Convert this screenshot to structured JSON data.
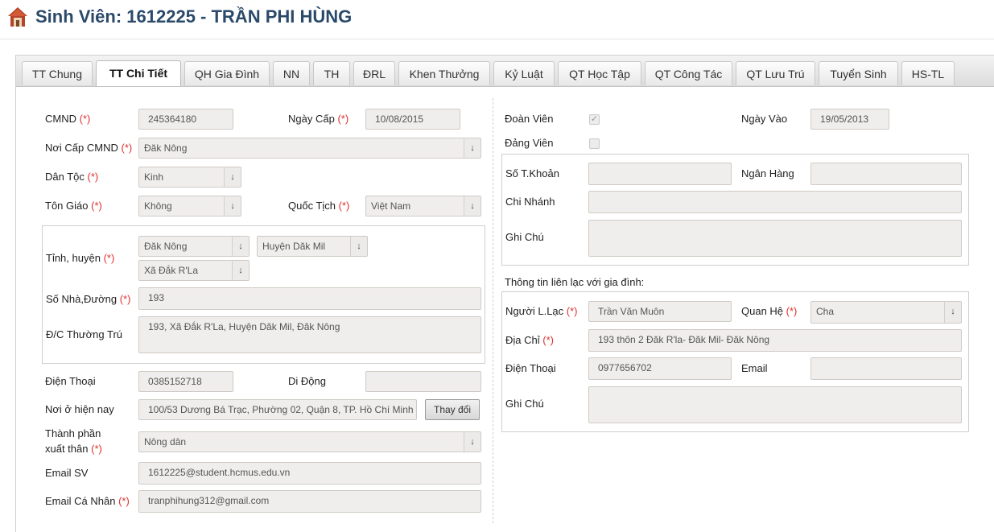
{
  "header": {
    "title": "Sinh Viên: 1612225 - TRẦN PHI HÙNG",
    "icon": "home-icon"
  },
  "tabs": [
    "TT Chung",
    "TT Chi Tiết",
    "QH Gia Đình",
    "NN",
    "TH",
    "ĐRL",
    "Khen Thưởng",
    "Kỷ Luật",
    "QT Học Tập",
    "QT Công Tác",
    "QT Lưu Trú",
    "Tuyển Sinh",
    "HS-TL"
  ],
  "active_tab": "TT Chi Tiết",
  "required_mark": "(*)",
  "left": {
    "cmnd": {
      "label": "CMND",
      "value": "245364180"
    },
    "ngay_cap": {
      "label": "Ngày Cấp",
      "value": "10/08/2015"
    },
    "noi_cap": {
      "label": "Nơi Cấp CMND",
      "value": "Đăk Nông"
    },
    "dan_toc": {
      "label": "Dân Tộc",
      "value": "Kinh"
    },
    "ton_giao": {
      "label": "Tôn Giáo",
      "value": "Không"
    },
    "quoc_tich": {
      "label": "Quốc Tịch",
      "value": "Việt Nam"
    },
    "tinh_huyen": {
      "label": "Tỉnh, huyện",
      "tinh": "Đăk Nông",
      "huyen": "Huyện Dăk Mil",
      "xa": "Xã Đắk R'La"
    },
    "so_nha": {
      "label": "Số Nhà,Đường",
      "value": "193"
    },
    "dc_thuong_tru": {
      "label": "Đ/C Thường Trú",
      "value": "193, Xã Đắk R'La, Huyện Dăk Mil, Đăk Nông"
    },
    "dien_thoai": {
      "label": "Điện Thoại",
      "value": "0385152718"
    },
    "di_dong": {
      "label": "Di Động",
      "value": ""
    },
    "noi_o": {
      "label": "Nơi ở hiện nay",
      "value": "100/53 Dương Bá Trạc, Phường 02, Quận 8, TP. Hồ Chí Minh",
      "button": "Thay đổi"
    },
    "thanh_phan": {
      "label_line1": "Thành phần",
      "label_line2": "xuất thân",
      "value": "Nông dân"
    },
    "email_sv": {
      "label": "Email SV",
      "value": "1612225@student.hcmus.edu.vn"
    },
    "email_cn": {
      "label": "Email Cá Nhân",
      "value": "tranphihung312@gmail.com"
    }
  },
  "right": {
    "doan_vien": {
      "label": "Đoàn Viên",
      "checked": true
    },
    "ngay_vao": {
      "label": "Ngày Vào",
      "value": "19/05/2013"
    },
    "dang_vien": {
      "label": "Đảng Viên",
      "checked": false
    },
    "so_tk": {
      "label": "Số T.Khoản",
      "value": ""
    },
    "ngan_hang": {
      "label": "Ngân Hàng",
      "value": ""
    },
    "chi_nhanh": {
      "label": "Chi Nhánh",
      "value": ""
    },
    "ghi_chu": {
      "label": "Ghi Chú",
      "value": ""
    },
    "family_heading": "Thông tin liên lạc với gia đình:",
    "nguoi_lac": {
      "label": "Người L.Lạc",
      "value": "Trần Văn Muôn"
    },
    "quan_he": {
      "label": "Quan Hệ",
      "value": "Cha"
    },
    "dia_chi": {
      "label": "Địa Chỉ",
      "value": "193 thôn 2 Đăk R'la- Đăk Mil- Đăk Nông"
    },
    "dien_thoai": {
      "label": "Điện Thoại",
      "value": "0977656702"
    },
    "email": {
      "label": "Email",
      "value": ""
    },
    "ghi_chu2": {
      "label": "Ghi Chú",
      "value": ""
    }
  }
}
